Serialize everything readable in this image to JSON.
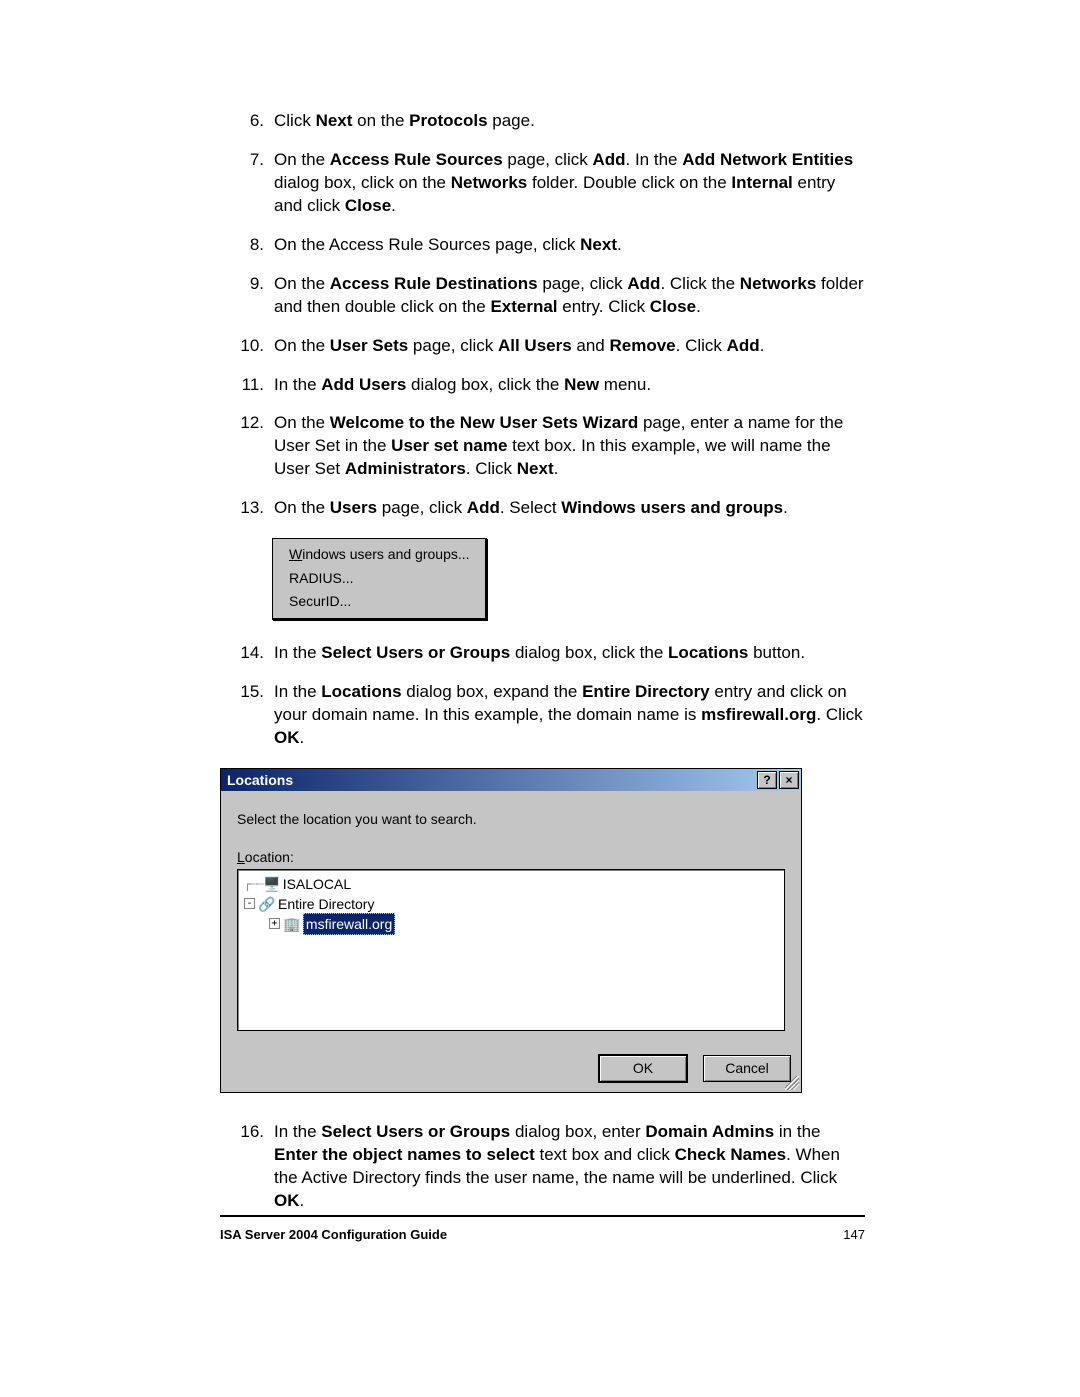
{
  "steps": [
    {
      "num": "6.",
      "html": "Click <b>Next</b> on the <b>Protocols</b> page."
    },
    {
      "num": "7.",
      "html": "On the <b>Access Rule Sources</b> page, click <b>Add</b>. In the <b>Add Network Entities</b> dialog box, click on the <b>Networks</b> folder. Double click on the <b>Internal</b> entry and click <b>Close</b>."
    },
    {
      "num": "8.",
      "html": "On the Access Rule Sources page, click <b>Next</b>."
    },
    {
      "num": "9.",
      "html": "On the <b>Access Rule Destinations</b> page, click <b>Add</b>. Click the <b>Networks</b> folder and then double click on the <b>External</b> entry. Click <b>Close</b>."
    },
    {
      "num": "10.",
      "html": "On the <b>User Sets</b> page, click <b>All Users</b> and <b>Remove</b>. Click <b>Add</b>."
    },
    {
      "num": "11.",
      "html": "In the <b>Add Users</b> dialog box, click the <b>New</b> menu."
    },
    {
      "num": "12.",
      "html": "On the <b>Welcome to the New User Sets Wizard</b> page, enter a name for the User Set in the <b>User set name</b> text box. In this example, we will name the User Set <b>Administrators</b>. Click <b>Next</b>."
    },
    {
      "num": "13.",
      "html": "On the <b>Users</b> page, click <b>Add</b>. Select <b>Windows users and groups</b>."
    }
  ],
  "menu": {
    "item1_accel": "W",
    "item1_rest": "indows users and groups...",
    "item2": "RADIUS...",
    "item3": "SecurID..."
  },
  "steps2": [
    {
      "num": "14.",
      "html": "In the <b>Select Users or Groups</b> dialog box, click the <b>Locations</b> button."
    },
    {
      "num": "15.",
      "html": "In the <b>Locations</b> dialog box, expand the <b>Entire Directory</b> entry and click on your domain name. In this example, the domain name is <b>msfirewall.org</b>. Click <b>OK</b>."
    }
  ],
  "dialog": {
    "title": "Locations",
    "help": "?",
    "close": "×",
    "prompt": "Select the location you want to search.",
    "field_label_accel": "L",
    "field_label_rest": "ocation:",
    "tree": {
      "node1": "ISALOCAL",
      "node2": "Entire Directory",
      "node3": "msfirewall.org"
    },
    "ok": "OK",
    "cancel": "Cancel"
  },
  "steps3": [
    {
      "num": "16.",
      "html": "In the <b>Select Users or Groups</b> dialog box, enter <b>Domain Admins</b> in the <b>Enter the object names to select</b> text box and click <b>Check Names</b>. When the Active Directory finds the user name, the name will be underlined. Click <b>OK</b>."
    }
  ],
  "footer": {
    "title": "ISA Server 2004 Configuration Guide",
    "page": "147"
  }
}
